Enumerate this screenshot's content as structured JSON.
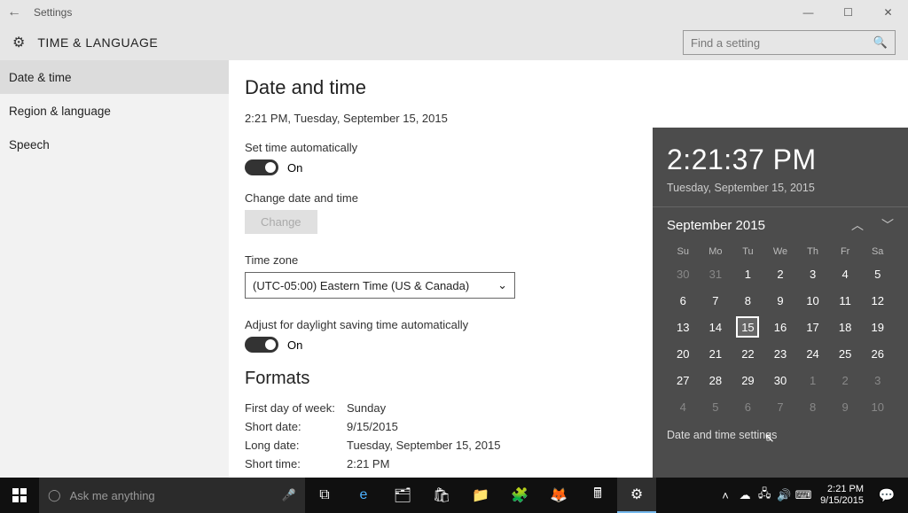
{
  "titlebar": {
    "title": "Settings",
    "back_glyph": "←",
    "min": "—",
    "max": "☐",
    "close": "✕"
  },
  "header": {
    "heading": "TIME & LANGUAGE",
    "search_placeholder": "Find a setting"
  },
  "sidebar": {
    "items": [
      {
        "label": "Date & time",
        "active": true
      },
      {
        "label": "Region & language",
        "active": false
      },
      {
        "label": "Speech",
        "active": false
      }
    ]
  },
  "main": {
    "title": "Date and time",
    "now_line": "2:21 PM, Tuesday, September 15, 2015",
    "auto_time_label": "Set time automatically",
    "auto_time_state": "On",
    "change_section_label": "Change date and time",
    "change_button": "Change",
    "tz_label": "Time zone",
    "tz_value": "(UTC-05:00) Eastern Time (US & Canada)",
    "dst_label": "Adjust for daylight saving time automatically",
    "dst_state": "On",
    "formats_title": "Formats",
    "fmt": {
      "first_day_k": "First day of week:",
      "first_day_v": "Sunday",
      "short_date_k": "Short date:",
      "short_date_v": "9/15/2015",
      "long_date_k": "Long date:",
      "long_date_v": "Tuesday, September 15, 2015",
      "short_time_k": "Short time:",
      "short_time_v": "2:21 PM"
    }
  },
  "flyout": {
    "time": "2:21:37 PM",
    "date": "Tuesday, September 15, 2015",
    "month": "September 2015",
    "dow": [
      "Su",
      "Mo",
      "Tu",
      "We",
      "Th",
      "Fr",
      "Sa"
    ],
    "weeks": [
      [
        {
          "d": "30",
          "dim": true
        },
        {
          "d": "31",
          "dim": true
        },
        {
          "d": "1"
        },
        {
          "d": "2"
        },
        {
          "d": "3"
        },
        {
          "d": "4"
        },
        {
          "d": "5"
        }
      ],
      [
        {
          "d": "6"
        },
        {
          "d": "7"
        },
        {
          "d": "8"
        },
        {
          "d": "9"
        },
        {
          "d": "10"
        },
        {
          "d": "11"
        },
        {
          "d": "12"
        }
      ],
      [
        {
          "d": "13"
        },
        {
          "d": "14"
        },
        {
          "d": "15",
          "today": true
        },
        {
          "d": "16"
        },
        {
          "d": "17"
        },
        {
          "d": "18"
        },
        {
          "d": "19"
        }
      ],
      [
        {
          "d": "20"
        },
        {
          "d": "21"
        },
        {
          "d": "22"
        },
        {
          "d": "23"
        },
        {
          "d": "24"
        },
        {
          "d": "25"
        },
        {
          "d": "26"
        }
      ],
      [
        {
          "d": "27"
        },
        {
          "d": "28"
        },
        {
          "d": "29"
        },
        {
          "d": "30"
        },
        {
          "d": "1",
          "dim": true
        },
        {
          "d": "2",
          "dim": true
        },
        {
          "d": "3",
          "dim": true
        }
      ],
      [
        {
          "d": "4",
          "dim": true
        },
        {
          "d": "5",
          "dim": true
        },
        {
          "d": "6",
          "dim": true
        },
        {
          "d": "7",
          "dim": true
        },
        {
          "d": "8",
          "dim": true
        },
        {
          "d": "9",
          "dim": true
        },
        {
          "d": "10",
          "dim": true
        }
      ]
    ],
    "link": "Date and time settings"
  },
  "taskbar": {
    "search_placeholder": "Ask me anything",
    "clock_time": "2:21 PM",
    "clock_date": "9/15/2015"
  }
}
